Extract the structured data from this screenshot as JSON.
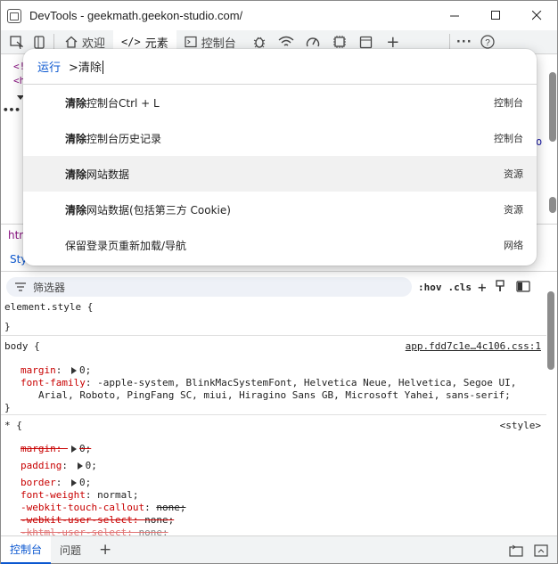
{
  "window": {
    "title": "DevTools - geekmath.geekon-studio.com/"
  },
  "tabs": [
    {
      "label": "欢迎"
    },
    {
      "label": "元素"
    },
    {
      "label": "控制台"
    }
  ],
  "elements_pane": {
    "lines": [
      "<!",
      "<h",
      "•••"
    ],
    "right_fragment": "o",
    "breadcrumb": "htm"
  },
  "styles_tab": {
    "label": "Style"
  },
  "filter": {
    "placeholder": "筛选器",
    "hov": ":hov",
    "cls": ".cls"
  },
  "styles": {
    "element_style": {
      "selector": "element.style {",
      "close": "}"
    },
    "body_rule": {
      "selector": "body {",
      "source": "app.fdd7c1e…4c106.css:1",
      "margin": {
        "name": "margin",
        "value": "0;"
      },
      "font_family": {
        "name": "font-family",
        "value": "-apple-system, BlinkMacSystemFont, Helvetica Neue, Helvetica, Segoe UI,",
        "value2": "Arial, Roboto, PingFang SC, miui, Hiragino Sans GB, Microsoft Yahei, sans-serif;"
      },
      "close": "}"
    },
    "star_rule": {
      "selector": "* {",
      "source": "<style>",
      "margin": {
        "name": "margin",
        "value": "0;"
      },
      "padding": {
        "name": "padding",
        "value": "0;"
      },
      "border": {
        "name": "border",
        "value": "0;"
      },
      "font_weight": {
        "name": "font-weight",
        "value": "normal;"
      },
      "touch_callout": {
        "name": "-webkit-touch-callout",
        "value": "none;"
      },
      "user_select": {
        "name": "-webkit-user-select",
        "value": "none;"
      },
      "khtml": {
        "name": "-khtml-user-select",
        "value": "none;"
      }
    }
  },
  "command_menu": {
    "run_label": "运行",
    "query": ">清除",
    "items": [
      {
        "bold": "清除",
        "rest": "控制台Ctrl + L",
        "category": "控制台"
      },
      {
        "bold": "清除",
        "rest": "控制台历史记录",
        "category": "控制台"
      },
      {
        "bold": "清除",
        "rest": "网站数据",
        "category": "资源"
      },
      {
        "bold": "清除",
        "rest": "网站数据(包括第三方 Cookie)",
        "category": "资源"
      },
      {
        "bold": "",
        "rest": "保留登录页重新加载/导航",
        "category": "网络"
      }
    ]
  },
  "drawer": {
    "tabs": [
      {
        "label": "控制台"
      },
      {
        "label": "问题"
      }
    ]
  },
  "colors": {
    "accent": "#0b57d0",
    "property": "#c80000",
    "warning": "#e37400"
  }
}
